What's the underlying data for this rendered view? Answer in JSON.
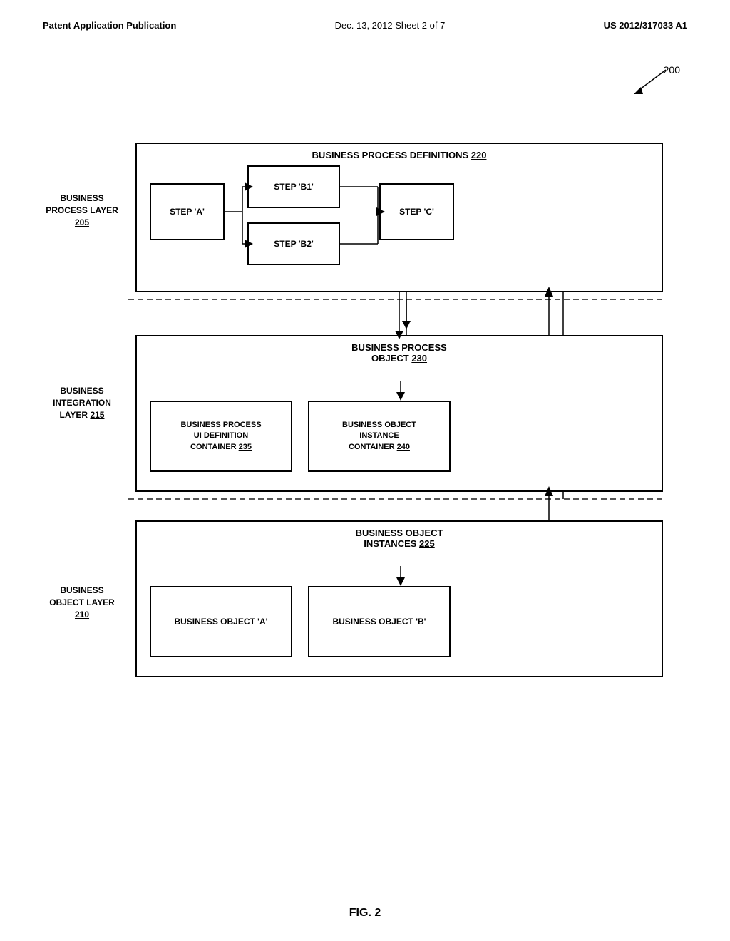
{
  "header": {
    "left": "Patent Application Publication",
    "center": "Dec. 13, 2012   Sheet 2 of 7",
    "right": "US 2012/317033 A1"
  },
  "fig_label": "FIG. 2",
  "ref_200": "200",
  "layers": {
    "business_process": {
      "label": "BUSINESS\nPROCESS LAYER\n205",
      "underline_part": "205"
    },
    "business_integration": {
      "label": "BUSINESS\nINTEGRATION\nLAYER 215",
      "underline_part": "215"
    },
    "business_object": {
      "label": "BUSINESS\nOBJECT LAYER\n210",
      "underline_part": "210"
    }
  },
  "boxes": {
    "bpd_title": "BUSINESS PROCESS DEFINITIONS 220",
    "bpd_220_num": "220",
    "step_a": "STEP 'A'",
    "step_b1": "STEP 'B1'",
    "step_b2": "STEP 'B2'",
    "step_c": "STEP 'C'",
    "bpo_title": "BUSINESS PROCESS\nOBJECT 230",
    "bpuic_title": "BUSINESS PROCESS\nUI DEFINITION\nCONTAINER 235",
    "boic_title": "BUSINESS OBJECT\nINSTANCE\nCONTAINER 240",
    "boi_title": "BUSINESS OBJECT\nINSTANCES 225",
    "bo_a": "BUSINESS OBJECT 'A'",
    "bo_b": "BUSINESS OBJECT 'B'"
  }
}
